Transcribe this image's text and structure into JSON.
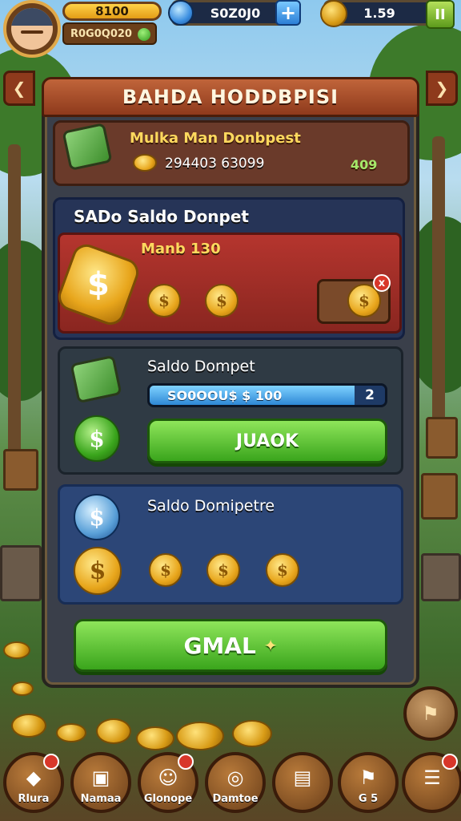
{
  "hud": {
    "energy_value": "8100",
    "level_text": "R0G0Q020",
    "gems_value": "S0Z0J0",
    "gems_plus": "+",
    "coins_value": "1.59",
    "menu_glyph": "II"
  },
  "panel": {
    "title": "BAHDA HODDBPISI",
    "left_arrow": "❮",
    "right_arrow": "❯"
  },
  "card_wallet": {
    "label": "Mulka Man Donbpest",
    "amount": "294403 63099",
    "bonus": "409"
  },
  "card_saldo": {
    "title": "SADo Saldo Donpet",
    "subtitle": "Manb 130",
    "coin_symbol": "$",
    "close_glyph": "x"
  },
  "card_progress": {
    "title": "Saldo Dompet",
    "progress_text": "SO0OOU$ $ 100",
    "progress_count": "2",
    "progress_fraction": 0.88,
    "button_label": "JUAOK"
  },
  "card_coins": {
    "title": "Saldo Domipetre"
  },
  "main_button": {
    "label": "GMAL",
    "sparkle": "✦"
  },
  "bottom_nav": [
    {
      "label": "Rlura",
      "icon": "fish-icon",
      "glyph": "◆"
    },
    {
      "label": "Namaa",
      "icon": "card-icon",
      "glyph": "▣"
    },
    {
      "label": "Glonope",
      "icon": "hero-icon",
      "glyph": "☺"
    },
    {
      "label": "Damtoe",
      "icon": "coin-stack-icon",
      "glyph": "◎"
    },
    {
      "label": "",
      "icon": "gift-box-icon",
      "glyph": "▤"
    },
    {
      "label": "G 5",
      "icon": "trophy-icon",
      "glyph": "⚑"
    },
    {
      "label": "",
      "icon": "menu-icon",
      "glyph": "☰"
    }
  ],
  "colors": {
    "banner": "#8e3a1c",
    "green_button": "#3aa51c",
    "gold": "#e8a61c"
  }
}
